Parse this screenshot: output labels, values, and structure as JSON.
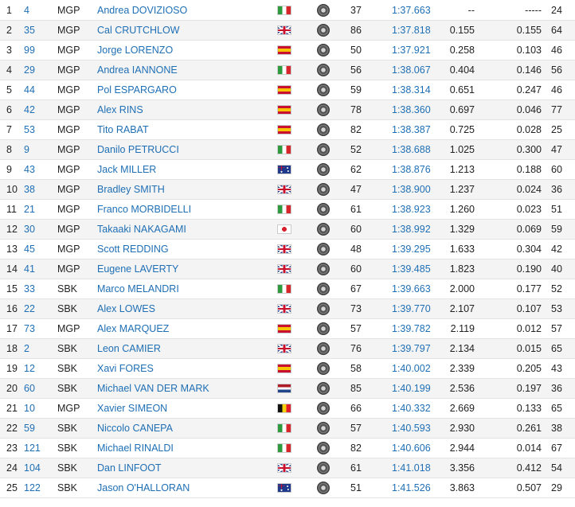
{
  "table": {
    "rows": [
      {
        "pos": "1",
        "number": "4",
        "class": "MGP",
        "rider": "Andrea DOVIZIOSO",
        "flag": "it",
        "laps": "37",
        "time": "1:37.663",
        "gap_first": "--",
        "gap_prev": "-----",
        "best_lap": "24"
      },
      {
        "pos": "2",
        "number": "35",
        "class": "MGP",
        "rider": "Cal CRUTCHLOW",
        "flag": "gb",
        "laps": "86",
        "time": "1:37.818",
        "gap_first": "0.155",
        "gap_prev": "0.155",
        "best_lap": "64"
      },
      {
        "pos": "3",
        "number": "99",
        "class": "MGP",
        "rider": "Jorge LORENZO",
        "flag": "es",
        "laps": "50",
        "time": "1:37.921",
        "gap_first": "0.258",
        "gap_prev": "0.103",
        "best_lap": "46"
      },
      {
        "pos": "4",
        "number": "29",
        "class": "MGP",
        "rider": "Andrea IANNONE",
        "flag": "it",
        "laps": "56",
        "time": "1:38.067",
        "gap_first": "0.404",
        "gap_prev": "0.146",
        "best_lap": "56"
      },
      {
        "pos": "5",
        "number": "44",
        "class": "MGP",
        "rider": "Pol ESPARGARO",
        "flag": "es",
        "laps": "59",
        "time": "1:38.314",
        "gap_first": "0.651",
        "gap_prev": "0.247",
        "best_lap": "46"
      },
      {
        "pos": "6",
        "number": "42",
        "class": "MGP",
        "rider": "Alex RINS",
        "flag": "es",
        "laps": "78",
        "time": "1:38.360",
        "gap_first": "0.697",
        "gap_prev": "0.046",
        "best_lap": "77"
      },
      {
        "pos": "7",
        "number": "53",
        "class": "MGP",
        "rider": "Tito RABAT",
        "flag": "es",
        "laps": "82",
        "time": "1:38.387",
        "gap_first": "0.725",
        "gap_prev": "0.028",
        "best_lap": "25"
      },
      {
        "pos": "8",
        "number": "9",
        "class": "MGP",
        "rider": "Danilo PETRUCCI",
        "flag": "it",
        "laps": "52",
        "time": "1:38.688",
        "gap_first": "1.025",
        "gap_prev": "0.300",
        "best_lap": "47"
      },
      {
        "pos": "9",
        "number": "43",
        "class": "MGP",
        "rider": "Jack MILLER",
        "flag": "au",
        "laps": "62",
        "time": "1:38.876",
        "gap_first": "1.213",
        "gap_prev": "0.188",
        "best_lap": "60"
      },
      {
        "pos": "10",
        "number": "38",
        "class": "MGP",
        "rider": "Bradley SMITH",
        "flag": "gb",
        "laps": "47",
        "time": "1:38.900",
        "gap_first": "1.237",
        "gap_prev": "0.024",
        "best_lap": "36"
      },
      {
        "pos": "11",
        "number": "21",
        "class": "MGP",
        "rider": "Franco MORBIDELLI",
        "flag": "it",
        "laps": "61",
        "time": "1:38.923",
        "gap_first": "1.260",
        "gap_prev": "0.023",
        "best_lap": "51"
      },
      {
        "pos": "12",
        "number": "30",
        "class": "MGP",
        "rider": "Takaaki NAKAGAMI",
        "flag": "jp",
        "laps": "60",
        "time": "1:38.992",
        "gap_first": "1.329",
        "gap_prev": "0.069",
        "best_lap": "59"
      },
      {
        "pos": "13",
        "number": "45",
        "class": "MGP",
        "rider": "Scott REDDING",
        "flag": "gb",
        "laps": "48",
        "time": "1:39.295",
        "gap_first": "1.633",
        "gap_prev": "0.304",
        "best_lap": "42"
      },
      {
        "pos": "14",
        "number": "41",
        "class": "MGP",
        "rider": "Eugene LAVERTY",
        "flag": "gb",
        "laps": "60",
        "time": "1:39.485",
        "gap_first": "1.823",
        "gap_prev": "0.190",
        "best_lap": "40"
      },
      {
        "pos": "15",
        "number": "33",
        "class": "SBK",
        "rider": "Marco MELANDRI",
        "flag": "it",
        "laps": "67",
        "time": "1:39.663",
        "gap_first": "2.000",
        "gap_prev": "0.177",
        "best_lap": "52"
      },
      {
        "pos": "16",
        "number": "22",
        "class": "SBK",
        "rider": "Alex LOWES",
        "flag": "gb",
        "laps": "73",
        "time": "1:39.770",
        "gap_first": "2.107",
        "gap_prev": "0.107",
        "best_lap": "53"
      },
      {
        "pos": "17",
        "number": "73",
        "class": "MGP",
        "rider": "Alex MARQUEZ",
        "flag": "es",
        "laps": "57",
        "time": "1:39.782",
        "gap_first": "2.119",
        "gap_prev": "0.012",
        "best_lap": "57"
      },
      {
        "pos": "18",
        "number": "2",
        "class": "SBK",
        "rider": "Leon CAMIER",
        "flag": "gb",
        "laps": "76",
        "time": "1:39.797",
        "gap_first": "2.134",
        "gap_prev": "0.015",
        "best_lap": "65"
      },
      {
        "pos": "19",
        "number": "12",
        "class": "SBK",
        "rider": "Xavi FORES",
        "flag": "es",
        "laps": "58",
        "time": "1:40.002",
        "gap_first": "2.339",
        "gap_prev": "0.205",
        "best_lap": "43"
      },
      {
        "pos": "20",
        "number": "60",
        "class": "SBK",
        "rider": "Michael VAN DER MARK",
        "flag": "nl",
        "laps": "85",
        "time": "1:40.199",
        "gap_first": "2.536",
        "gap_prev": "0.197",
        "best_lap": "36"
      },
      {
        "pos": "21",
        "number": "10",
        "class": "MGP",
        "rider": "Xavier SIMEON",
        "flag": "be",
        "laps": "66",
        "time": "1:40.332",
        "gap_first": "2.669",
        "gap_prev": "0.133",
        "best_lap": "65"
      },
      {
        "pos": "22",
        "number": "59",
        "class": "SBK",
        "rider": "Niccolo CANEPA",
        "flag": "it",
        "laps": "57",
        "time": "1:40.593",
        "gap_first": "2.930",
        "gap_prev": "0.261",
        "best_lap": "38"
      },
      {
        "pos": "23",
        "number": "121",
        "class": "SBK",
        "rider": "Michael RINALDI",
        "flag": "it",
        "laps": "82",
        "time": "1:40.606",
        "gap_first": "2.944",
        "gap_prev": "0.014",
        "best_lap": "67"
      },
      {
        "pos": "24",
        "number": "104",
        "class": "SBK",
        "rider": "Dan LINFOOT",
        "flag": "gb",
        "laps": "61",
        "time": "1:41.018",
        "gap_first": "3.356",
        "gap_prev": "0.412",
        "best_lap": "54"
      },
      {
        "pos": "25",
        "number": "122",
        "class": "SBK",
        "rider": "Jason O'HALLORAN",
        "flag": "au",
        "laps": "51",
        "time": "1:41.526",
        "gap_first": "3.863",
        "gap_prev": "0.507",
        "best_lap": "29"
      }
    ]
  }
}
